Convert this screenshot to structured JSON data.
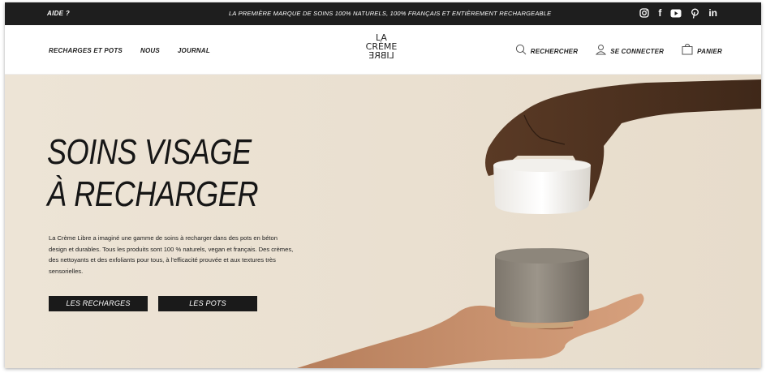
{
  "topbar": {
    "help": "AIDE ?",
    "tagline": "LA PREMIÈRE MARQUE DE SOINS 100% NATURELS, 100% FRANÇAIS ET ENTIÈREMENT RECHARGEABLE",
    "social": [
      {
        "icon": "instagram-icon"
      },
      {
        "icon": "facebook-icon",
        "glyph": "f"
      },
      {
        "icon": "youtube-icon"
      },
      {
        "icon": "pinterest-icon",
        "glyph": "P"
      },
      {
        "icon": "linkedin-icon",
        "glyph": "in"
      }
    ]
  },
  "nav": {
    "left": [
      "RECHARGES ET POTS",
      "NOUS",
      "JOURNAL"
    ],
    "logo": [
      "LA",
      "CRÈME",
      "LIBRE"
    ],
    "search": "RECHERCHER",
    "login": "SE CONNECTER",
    "cart": "PANIER"
  },
  "hero": {
    "title_line1": "SOINS VISAGE",
    "title_line2": "À RECHARGER",
    "description": "La Crème Libre a imaginé une gamme de soins à recharger dans des pots en béton design et durables. Tous les produits sont 100 % naturels, vegan et français. Des crèmes, des nettoyants et des exfoliants pour tous, à l'efficacité prouvée et aux textures très sensorielles.",
    "button_recharges": "LES RECHARGES",
    "button_pots": "LES POTS"
  },
  "colors": {
    "topbar": "#1e1e1e",
    "hero_bg": "#ebe1d2",
    "button": "#1a1a1a"
  }
}
